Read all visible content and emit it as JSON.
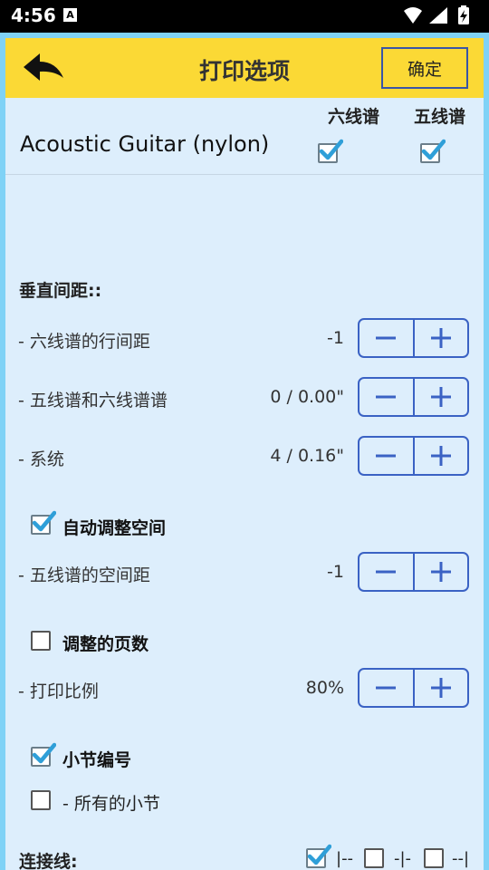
{
  "status_bar": {
    "time": "4:56",
    "app_badge": "A"
  },
  "header": {
    "title": "打印选项",
    "ok_label": "确定"
  },
  "columns": {
    "tab_label": "六线谱",
    "staff_label": "五线谱"
  },
  "instrument": {
    "name": "Acoustic Guitar (nylon)",
    "tab_checked": true,
    "staff_checked": true
  },
  "vertical_spacing": {
    "heading": "垂直间距::",
    "rows": [
      {
        "label": "- 六线谱的行间距",
        "value": "-1"
      },
      {
        "label": "- 五线谱和六线谱谱",
        "value": "0 / 0.00\""
      },
      {
        "label": "- 系统",
        "value": "4 / 0.16\""
      }
    ]
  },
  "auto_adjust": {
    "label": "自动调整空间",
    "checked": true,
    "row_label": "- 五线谱的空间距",
    "row_value": "-1"
  },
  "adjust_pages": {
    "label": "调整的页数",
    "checked": false,
    "row_label": "- 打印比例",
    "row_value": "80%"
  },
  "bar_numbers": {
    "label": "小节编号",
    "checked": true,
    "all_label": "- 所有的小节",
    "all_checked": false
  },
  "ties": {
    "label": "连接线:",
    "options": [
      {
        "label": "|--",
        "checked": true
      },
      {
        "label": "-|-",
        "checked": false
      },
      {
        "label": "--|",
        "checked": false
      }
    ]
  },
  "colors": {
    "accent_yellow": "#fbd935",
    "panel_bg": "#ddeefc",
    "frame": "#7fd2f6",
    "stepper_blue": "#3a62c4",
    "check_blue": "#2f9fd8"
  }
}
